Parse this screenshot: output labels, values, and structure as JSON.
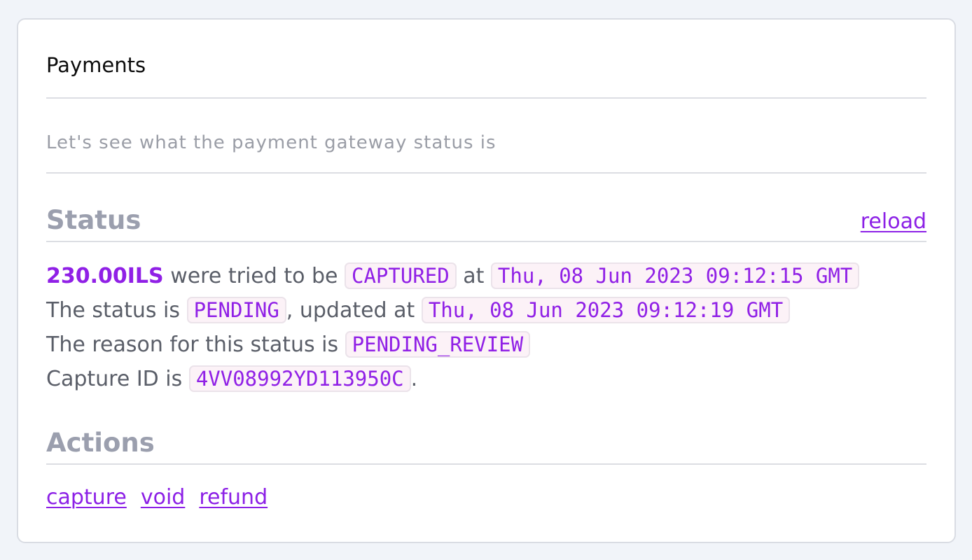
{
  "card": {
    "title": "Payments",
    "subtitle": "Let's see what the payment gateway status is"
  },
  "status": {
    "heading": "Status",
    "reload_label": "reload",
    "line1": {
      "amount": "230.00ILS",
      "text_a": " were tried to be ",
      "action": "CAPTURED",
      "text_b": " at ",
      "tried_at": "Thu, 08 Jun 2023 09:12:15 GMT"
    },
    "line2": {
      "text_a": "The status is ",
      "status": "PENDING",
      "text_b": ", updated at ",
      "updated_at": "Thu, 08 Jun 2023 09:12:19 GMT"
    },
    "line3": {
      "text_a": "The reason for this status is ",
      "reason": "PENDING_REVIEW"
    },
    "line4": {
      "text_a": "Capture ID is ",
      "capture_id": "4VV08992YD113950C",
      "text_b": "."
    }
  },
  "actions": {
    "heading": "Actions",
    "items": [
      {
        "label": "capture"
      },
      {
        "label": "void"
      },
      {
        "label": "refund"
      }
    ]
  },
  "colors": {
    "accent": "#9020e6",
    "code_bg": "#fcf2f7",
    "muted_heading": "#9b9fae",
    "page_bg": "#f1f4f9"
  }
}
